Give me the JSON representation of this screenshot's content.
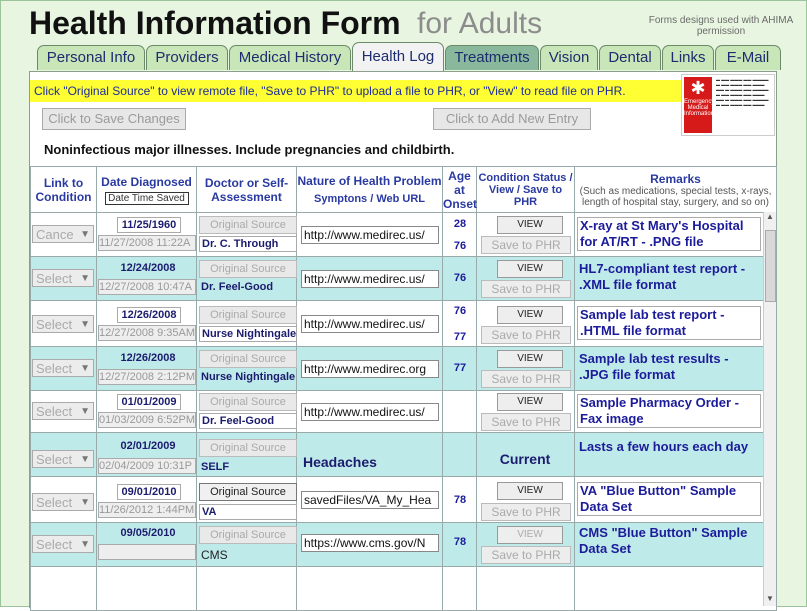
{
  "title": "Health Information Form",
  "subtitle": "for Adults",
  "credit": "Forms designs used with AHIMA permission",
  "tabs": [
    "Personal Info",
    "Providers",
    "Medical History",
    "Health Log",
    "Treatments",
    "Vision",
    "Dental",
    "Links",
    "E-Mail"
  ],
  "active_tab": "Health Log",
  "notice": "Click \"Original Source\" to view remote file, \"Save to PHR\" to upload a file to PHR, or \"View\" to read file on PHR.",
  "buttons": {
    "save_changes": "Click to Save Changes",
    "add_entry": "Click to Add New Entry"
  },
  "instruction": "Noninfectious major illnesses.  Include pregnancies and childbirth.",
  "headers": {
    "link": "Link to Condition",
    "date": "Date Diagnosed",
    "date_saved": "Date Time Saved",
    "doctor": "Doctor or Self-Assessment",
    "nature": "Nature of Health Problem",
    "nature_sub": "Symptons / Web URL",
    "age": "Age at Onset",
    "status": "Condition Status / View / Save to PHR",
    "remarks": "Remarks",
    "remarks_sub": "(Such as medications, special tests, x-rays, length of hospital stay, surgery, and so on)"
  },
  "labels": {
    "original_source": "Original Source",
    "view": "VIEW",
    "save_phr": "Save to PHR"
  },
  "rows": [
    {
      "select": "Cance",
      "date": "11/25/1960",
      "saved": "11/27/2008 11:22A",
      "doctor": "Dr. C. Through",
      "url": "http://www.medirec.us/",
      "age": "28",
      "age2": "76",
      "status": "",
      "remark": "X-ray at St Mary's Hospital for AT/RT - .PNG file"
    },
    {
      "select": "Select",
      "date": "12/24/2008",
      "saved": "12/27/2008 10:47A",
      "doctor": "Dr. Feel-Good",
      "url": "http://www.medirec.us/",
      "age": "76",
      "age2": "",
      "status": "",
      "remark": "HL7-compliant test report - .XML file format"
    },
    {
      "select": "Select",
      "date": "12/26/2008",
      "saved": "12/27/2008 9:35AM",
      "doctor": "Nurse Nightingale",
      "url": "http://www.medirec.us/",
      "age": "76",
      "age2": "77",
      "status": "",
      "remark": "Sample lab test report - .HTML file format"
    },
    {
      "select": "Select",
      "date": "12/26/2008",
      "saved": "12/27/2008 2:12PM",
      "doctor": "Nurse Nightingale",
      "url": "http://www.medirec.org",
      "age": "77",
      "age2": "",
      "status": "",
      "remark": "Sample lab test results - .JPG file format"
    },
    {
      "select": "Select",
      "date": "01/01/2009",
      "saved": "01/03/2009 6:52PM",
      "doctor": "Dr. Feel-Good",
      "url": "http://www.medirec.us/",
      "age": "",
      "age2": "",
      "status": "",
      "remark": "Sample Pharmacy Order - Fax image"
    },
    {
      "select": "Select",
      "date": "02/01/2009",
      "saved": "02/04/2009 10:31P",
      "doctor": "SELF",
      "url": "Headaches",
      "age": "",
      "age2": "",
      "status": "Current",
      "remark": "Lasts a few hours each day"
    },
    {
      "select": "Select",
      "date": "09/01/2010",
      "saved": "11/26/2012 1:44PM",
      "doctor": "VA",
      "url": "savedFiles/VA_My_Hea",
      "age": "78",
      "age2": "",
      "status": "",
      "remark": "VA \"Blue Button\" Sample Data Set"
    },
    {
      "select": "Select",
      "date": "09/05/2010",
      "saved": "",
      "doctor": "CMS",
      "url": "https://www.cms.gov/N",
      "age": "78",
      "age2": "",
      "status": "",
      "remark": "CMS \"Blue Button\" Sample Data Set"
    }
  ]
}
